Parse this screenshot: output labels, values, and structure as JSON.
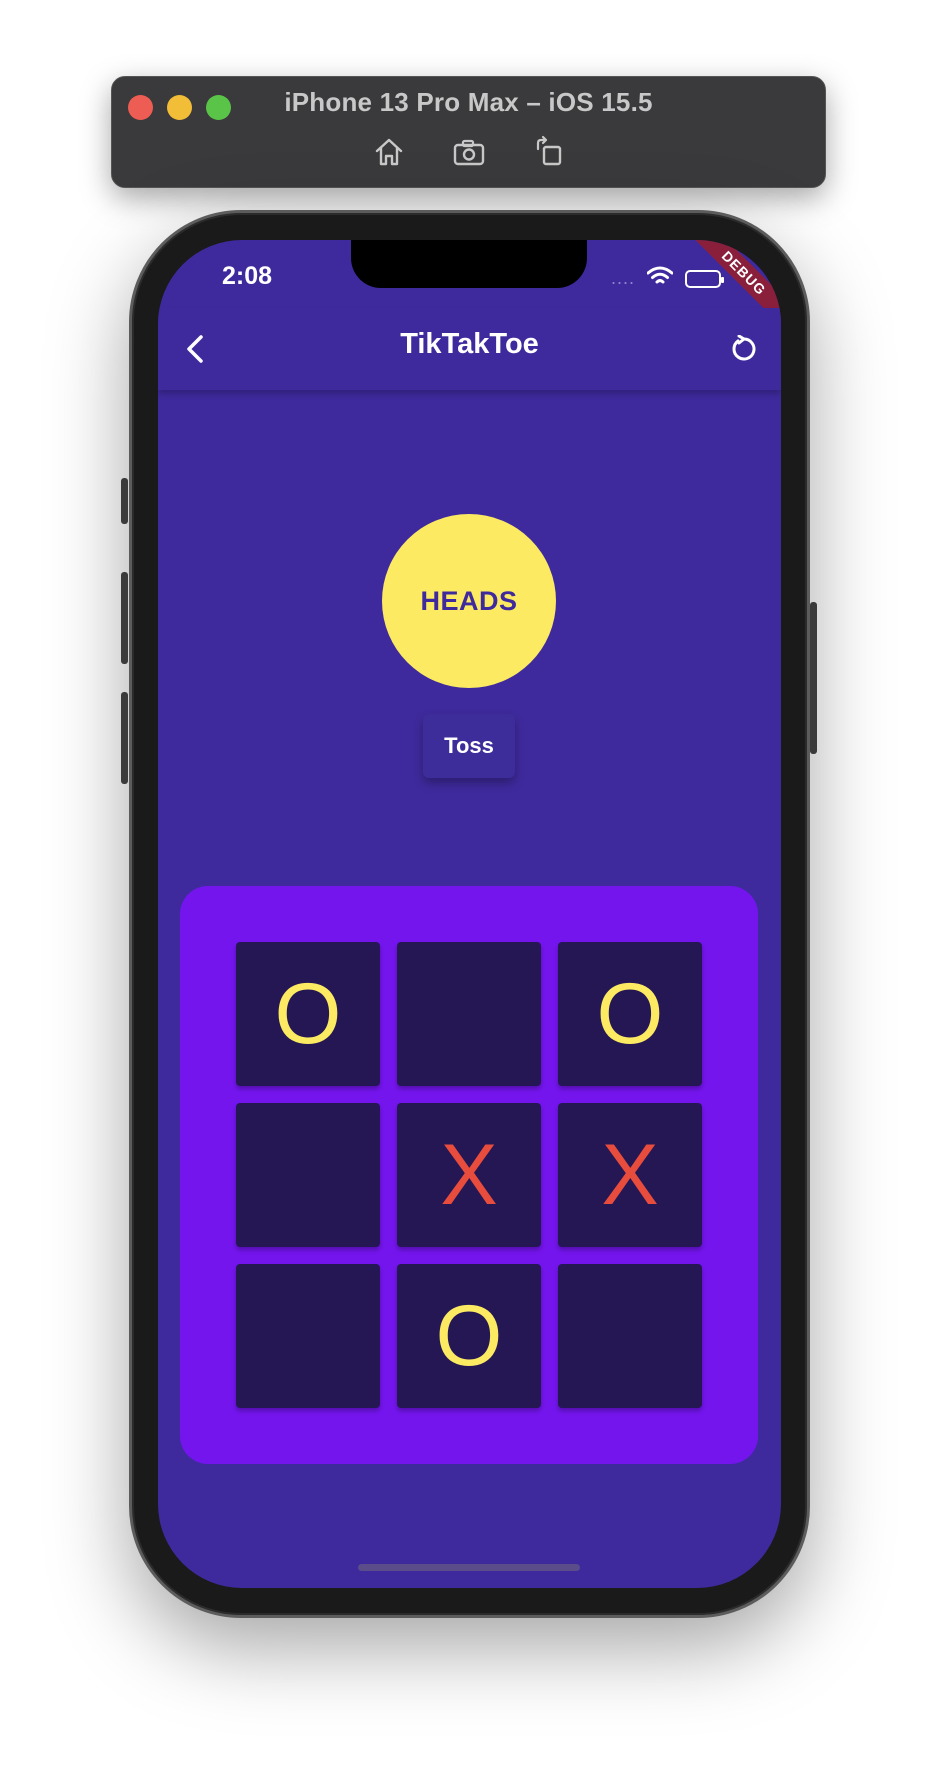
{
  "simulator": {
    "title": "iPhone 13 Pro Max – iOS 15.5",
    "tools": [
      "home-icon",
      "screenshot-icon",
      "rotate-icon"
    ]
  },
  "status_bar": {
    "time": "2:08",
    "signal": "....",
    "debug_banner": "DEBUG"
  },
  "app_bar": {
    "title": "TikTakToe",
    "back_icon": "chevron-left-icon",
    "refresh_icon": "refresh-icon"
  },
  "coin": {
    "label": "HEADS",
    "color": "#fbea62"
  },
  "toss_button": {
    "label": "Toss"
  },
  "board": {
    "cells": [
      "O",
      "",
      "O",
      "",
      "X",
      "X",
      "",
      "O",
      ""
    ],
    "colors": {
      "O": "#fbea62",
      "X": "#e84c3d",
      "background": "#7415ee",
      "cell": "#241754"
    }
  },
  "theme": {
    "primary": "#3f2a9d"
  }
}
